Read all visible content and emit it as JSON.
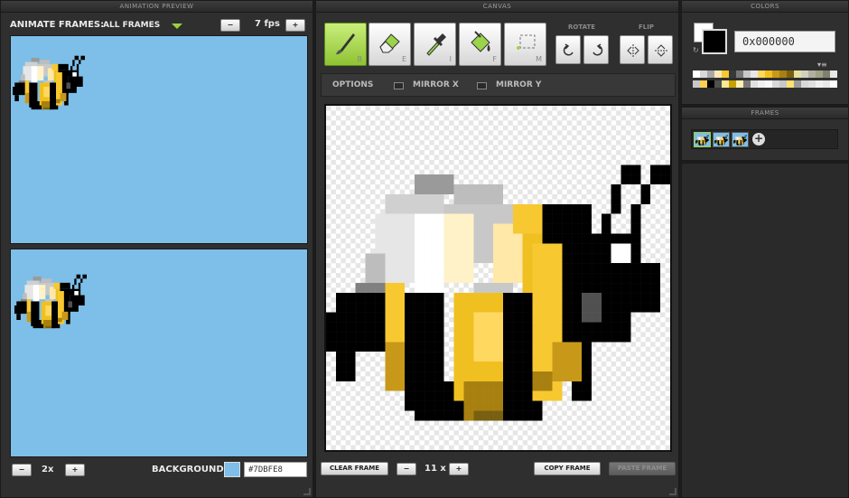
{
  "anim": {
    "title": "ANIMATION PREVIEW",
    "animate_label": "ANIMATE FRAMES:",
    "frames_option": "ALL FRAMES",
    "fps_minus": "−",
    "fps_value": "7 fps",
    "fps_plus": "+",
    "scale_minus": "−",
    "scale_value": "2x",
    "scale_plus": "+",
    "bg_label": "BACKGROUND",
    "bg_color": "#7DBFE8",
    "bg_value": "#7DBFE8"
  },
  "canvas": {
    "title": "CANVAS",
    "tools": [
      {
        "name": "brush",
        "key": "B",
        "active": true
      },
      {
        "name": "eraser",
        "key": "E",
        "active": false
      },
      {
        "name": "eyedropper",
        "key": "I",
        "active": false
      },
      {
        "name": "fill",
        "key": "F",
        "active": false
      },
      {
        "name": "select",
        "key": "M",
        "active": false
      }
    ],
    "rotate_label": "ROTATE",
    "flip_label": "FLIP",
    "options_label": "OPTIONS",
    "mirror_x_label": "MIRROR X",
    "mirror_y_label": "MIRROR Y",
    "clear_frame": "CLEAR FRAME",
    "zoom_minus": "−",
    "zoom_value": "11 x",
    "zoom_plus": "+",
    "copy_frame": "COPY FRAME",
    "paste_frame": "PASTE FRAME"
  },
  "colors": {
    "title": "COLORS",
    "primary": "#000000",
    "secondary": "#ffffff",
    "hex_value": "0x000000",
    "palette": [
      "#ffffff",
      "#d8d8d8",
      "#a8a8a8",
      "#ffe8b8",
      "#f8c830",
      "#383838",
      "#787878",
      "#c8c8c8",
      "#e8e8e8",
      "#ffd860",
      "#f0c020",
      "#c89818",
      "#a88010",
      "#786010",
      "#e8e0a0",
      "#d0d0c0",
      "#b0b0a0",
      "#a0a088",
      "#808070",
      "#e8e8e8",
      "#c8c8c8",
      "#ffd050",
      "#000000",
      "#505050",
      "#ffe890",
      "#c8a000",
      "#fff0b0",
      "#787878",
      "#e0e0e0",
      "#f0f0f0",
      "#f8f8f8",
      "#d8d8d8",
      "#c8c8c8",
      "#ffe070",
      "#9a9a9a",
      "#d8d8d8",
      "#e0e0e0",
      "#f0f0f0",
      "#e8e8e8",
      "#ffffff"
    ]
  },
  "frames": {
    "title": "FRAMES",
    "add_label": "+"
  }
}
